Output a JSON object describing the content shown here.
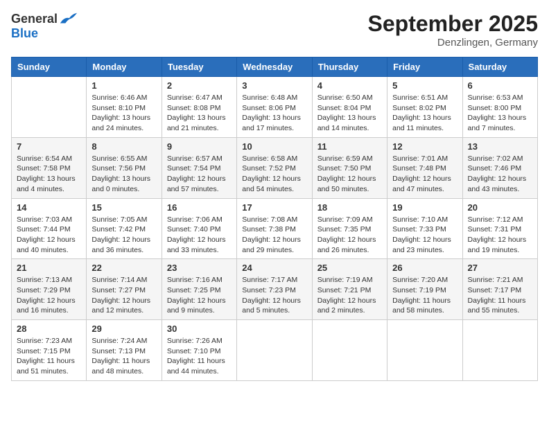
{
  "header": {
    "logo_general": "General",
    "logo_blue": "Blue",
    "month_title": "September 2025",
    "location": "Denzlingen, Germany"
  },
  "days_of_week": [
    "Sunday",
    "Monday",
    "Tuesday",
    "Wednesday",
    "Thursday",
    "Friday",
    "Saturday"
  ],
  "weeks": [
    [
      {
        "day": "",
        "sunrise": "",
        "sunset": "",
        "daylight": ""
      },
      {
        "day": "1",
        "sunrise": "Sunrise: 6:46 AM",
        "sunset": "Sunset: 8:10 PM",
        "daylight": "Daylight: 13 hours and 24 minutes."
      },
      {
        "day": "2",
        "sunrise": "Sunrise: 6:47 AM",
        "sunset": "Sunset: 8:08 PM",
        "daylight": "Daylight: 13 hours and 21 minutes."
      },
      {
        "day": "3",
        "sunrise": "Sunrise: 6:48 AM",
        "sunset": "Sunset: 8:06 PM",
        "daylight": "Daylight: 13 hours and 17 minutes."
      },
      {
        "day": "4",
        "sunrise": "Sunrise: 6:50 AM",
        "sunset": "Sunset: 8:04 PM",
        "daylight": "Daylight: 13 hours and 14 minutes."
      },
      {
        "day": "5",
        "sunrise": "Sunrise: 6:51 AM",
        "sunset": "Sunset: 8:02 PM",
        "daylight": "Daylight: 13 hours and 11 minutes."
      },
      {
        "day": "6",
        "sunrise": "Sunrise: 6:53 AM",
        "sunset": "Sunset: 8:00 PM",
        "daylight": "Daylight: 13 hours and 7 minutes."
      }
    ],
    [
      {
        "day": "7",
        "sunrise": "Sunrise: 6:54 AM",
        "sunset": "Sunset: 7:58 PM",
        "daylight": "Daylight: 13 hours and 4 minutes."
      },
      {
        "day": "8",
        "sunrise": "Sunrise: 6:55 AM",
        "sunset": "Sunset: 7:56 PM",
        "daylight": "Daylight: 13 hours and 0 minutes."
      },
      {
        "day": "9",
        "sunrise": "Sunrise: 6:57 AM",
        "sunset": "Sunset: 7:54 PM",
        "daylight": "Daylight: 12 hours and 57 minutes."
      },
      {
        "day": "10",
        "sunrise": "Sunrise: 6:58 AM",
        "sunset": "Sunset: 7:52 PM",
        "daylight": "Daylight: 12 hours and 54 minutes."
      },
      {
        "day": "11",
        "sunrise": "Sunrise: 6:59 AM",
        "sunset": "Sunset: 7:50 PM",
        "daylight": "Daylight: 12 hours and 50 minutes."
      },
      {
        "day": "12",
        "sunrise": "Sunrise: 7:01 AM",
        "sunset": "Sunset: 7:48 PM",
        "daylight": "Daylight: 12 hours and 47 minutes."
      },
      {
        "day": "13",
        "sunrise": "Sunrise: 7:02 AM",
        "sunset": "Sunset: 7:46 PM",
        "daylight": "Daylight: 12 hours and 43 minutes."
      }
    ],
    [
      {
        "day": "14",
        "sunrise": "Sunrise: 7:03 AM",
        "sunset": "Sunset: 7:44 PM",
        "daylight": "Daylight: 12 hours and 40 minutes."
      },
      {
        "day": "15",
        "sunrise": "Sunrise: 7:05 AM",
        "sunset": "Sunset: 7:42 PM",
        "daylight": "Daylight: 12 hours and 36 minutes."
      },
      {
        "day": "16",
        "sunrise": "Sunrise: 7:06 AM",
        "sunset": "Sunset: 7:40 PM",
        "daylight": "Daylight: 12 hours and 33 minutes."
      },
      {
        "day": "17",
        "sunrise": "Sunrise: 7:08 AM",
        "sunset": "Sunset: 7:38 PM",
        "daylight": "Daylight: 12 hours and 29 minutes."
      },
      {
        "day": "18",
        "sunrise": "Sunrise: 7:09 AM",
        "sunset": "Sunset: 7:35 PM",
        "daylight": "Daylight: 12 hours and 26 minutes."
      },
      {
        "day": "19",
        "sunrise": "Sunrise: 7:10 AM",
        "sunset": "Sunset: 7:33 PM",
        "daylight": "Daylight: 12 hours and 23 minutes."
      },
      {
        "day": "20",
        "sunrise": "Sunrise: 7:12 AM",
        "sunset": "Sunset: 7:31 PM",
        "daylight": "Daylight: 12 hours and 19 minutes."
      }
    ],
    [
      {
        "day": "21",
        "sunrise": "Sunrise: 7:13 AM",
        "sunset": "Sunset: 7:29 PM",
        "daylight": "Daylight: 12 hours and 16 minutes."
      },
      {
        "day": "22",
        "sunrise": "Sunrise: 7:14 AM",
        "sunset": "Sunset: 7:27 PM",
        "daylight": "Daylight: 12 hours and 12 minutes."
      },
      {
        "day": "23",
        "sunrise": "Sunrise: 7:16 AM",
        "sunset": "Sunset: 7:25 PM",
        "daylight": "Daylight: 12 hours and 9 minutes."
      },
      {
        "day": "24",
        "sunrise": "Sunrise: 7:17 AM",
        "sunset": "Sunset: 7:23 PM",
        "daylight": "Daylight: 12 hours and 5 minutes."
      },
      {
        "day": "25",
        "sunrise": "Sunrise: 7:19 AM",
        "sunset": "Sunset: 7:21 PM",
        "daylight": "Daylight: 12 hours and 2 minutes."
      },
      {
        "day": "26",
        "sunrise": "Sunrise: 7:20 AM",
        "sunset": "Sunset: 7:19 PM",
        "daylight": "Daylight: 11 hours and 58 minutes."
      },
      {
        "day": "27",
        "sunrise": "Sunrise: 7:21 AM",
        "sunset": "Sunset: 7:17 PM",
        "daylight": "Daylight: 11 hours and 55 minutes."
      }
    ],
    [
      {
        "day": "28",
        "sunrise": "Sunrise: 7:23 AM",
        "sunset": "Sunset: 7:15 PM",
        "daylight": "Daylight: 11 hours and 51 minutes."
      },
      {
        "day": "29",
        "sunrise": "Sunrise: 7:24 AM",
        "sunset": "Sunset: 7:13 PM",
        "daylight": "Daylight: 11 hours and 48 minutes."
      },
      {
        "day": "30",
        "sunrise": "Sunrise: 7:26 AM",
        "sunset": "Sunset: 7:10 PM",
        "daylight": "Daylight: 11 hours and 44 minutes."
      },
      {
        "day": "",
        "sunrise": "",
        "sunset": "",
        "daylight": ""
      },
      {
        "day": "",
        "sunrise": "",
        "sunset": "",
        "daylight": ""
      },
      {
        "day": "",
        "sunrise": "",
        "sunset": "",
        "daylight": ""
      },
      {
        "day": "",
        "sunrise": "",
        "sunset": "",
        "daylight": ""
      }
    ]
  ]
}
